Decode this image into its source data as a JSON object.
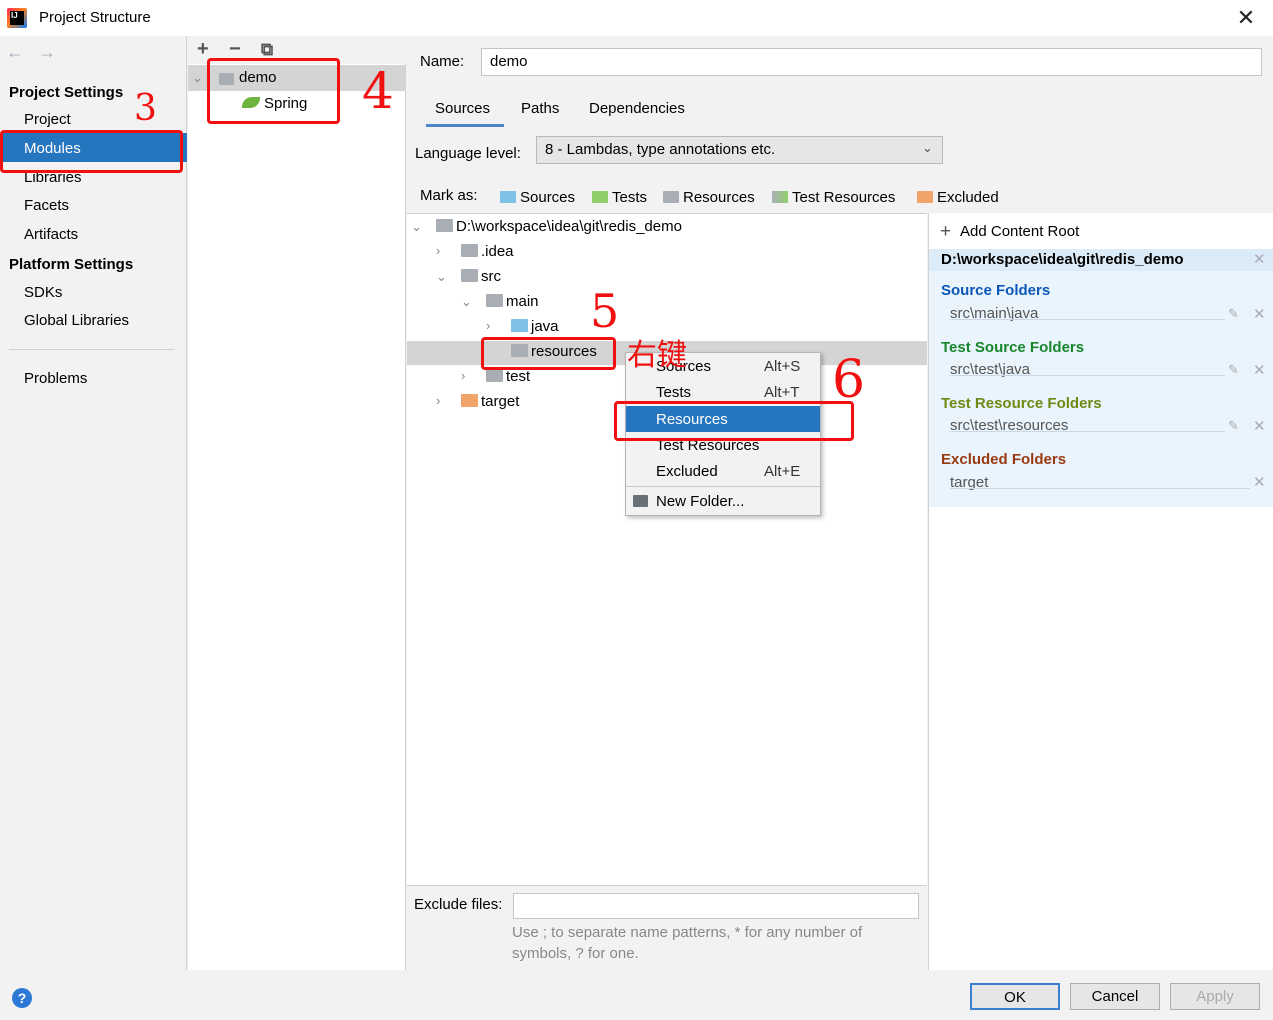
{
  "window": {
    "title": "Project Structure",
    "close": "✕"
  },
  "nav": {
    "back": "←",
    "forward": "→",
    "project_settings": "Project Settings",
    "project": "Project",
    "modules": "Modules",
    "libraries": "Libraries",
    "facets": "Facets",
    "artifacts": "Artifacts",
    "platform_settings": "Platform Settings",
    "sdks": "SDKs",
    "global_libraries": "Global Libraries",
    "problems": "Problems"
  },
  "modules": {
    "add": "+",
    "remove": "−",
    "copy": "⧉",
    "demo": "demo",
    "spring": "Spring"
  },
  "name": {
    "label": "Name:",
    "value": "demo"
  },
  "tabs": [
    "Sources",
    "Paths",
    "Dependencies"
  ],
  "language": {
    "label": "Language level:",
    "value": "8 - Lambdas, type annotations etc."
  },
  "mark_as": {
    "label": "Mark as:",
    "sources": "Sources",
    "tests": "Tests",
    "resources": "Resources",
    "test_resources": "Test Resources",
    "excluded": "Excluded"
  },
  "tree": {
    "root": "D:\\workspace\\idea\\git\\redis_demo",
    "idea": ".idea",
    "src": "src",
    "main": "main",
    "java": "java",
    "resources": "resources",
    "test": "test",
    "target": "target"
  },
  "context_menu": {
    "sources": "Sources",
    "sources_key": "Alt+S",
    "tests": "Tests",
    "tests_key": "Alt+T",
    "resources": "Resources",
    "test_resources": "Test Resources",
    "excluded": "Excluded",
    "excluded_key": "Alt+E",
    "new_folder": "New Folder..."
  },
  "content_root": {
    "add": "Add Content Root",
    "path": "D:\\workspace\\idea\\git\\redis_demo",
    "source_head": "Source Folders",
    "source_path": "src\\main\\java",
    "test_source_head": "Test Source Folders",
    "test_source_path": "src\\test\\java",
    "test_resource_head": "Test Resource Folders",
    "test_resource_path": "src\\test\\resources",
    "excluded_head": "Excluded Folders",
    "excluded_path": "target"
  },
  "exclude": {
    "label": "Exclude files:",
    "hint": "Use ; to separate name patterns, * for any number of symbols, ? for one."
  },
  "buttons": {
    "help": "?",
    "ok": "OK",
    "cancel": "Cancel",
    "apply": "Apply"
  },
  "annotations": {
    "n3": "3",
    "n4": "4",
    "n5": "5",
    "n6": "6",
    "right_click": "右键"
  },
  "colors": {
    "selection": "#2675bf",
    "source": "#0b58b8",
    "test": "#19852c",
    "test_resource": "#6e8a14",
    "excluded": "#9a3a12",
    "annotation": "#f01010"
  }
}
